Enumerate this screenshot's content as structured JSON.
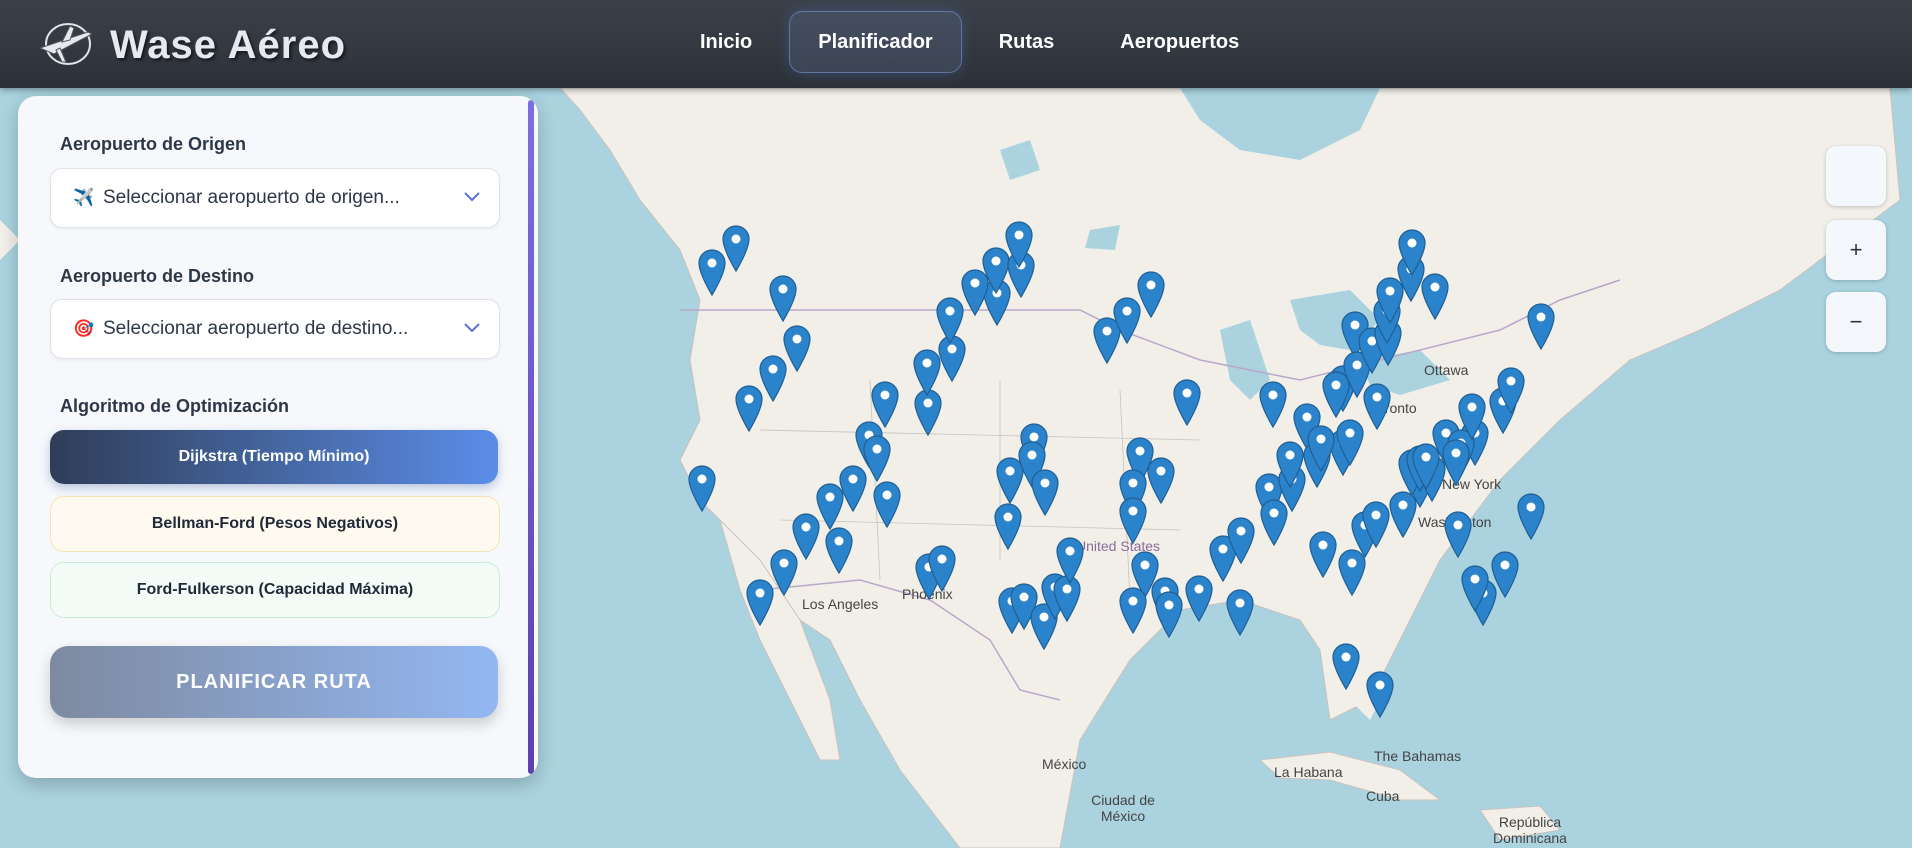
{
  "app": {
    "title": "Wase Aéreo"
  },
  "nav": [
    {
      "label": "Inicio",
      "active": false
    },
    {
      "label": "Planificador",
      "active": true
    },
    {
      "label": "Rutas",
      "active": false
    },
    {
      "label": "Aeropuertos",
      "active": false
    }
  ],
  "panel": {
    "origin": {
      "label": "Aeropuerto de Origen",
      "placeholder": "Seleccionar aeropuerto de origen...",
      "icon": "airplane-icon"
    },
    "destination": {
      "label": "Aeropuerto de Destino",
      "placeholder": "Seleccionar aeropuerto de destino...",
      "icon": "target-icon"
    },
    "algorithm": {
      "label": "Algoritmo de Optimización",
      "options": [
        {
          "label": "Dijkstra (Tiempo Mínimo)",
          "selected": true
        },
        {
          "label": "Bellman-Ford (Pesos Negativos)",
          "selected": false
        },
        {
          "label": "Ford-Fulkerson (Capacidad Máxima)",
          "selected": false
        }
      ]
    },
    "plan_button": "PLANIFICAR RUTA"
  },
  "map": {
    "controls": {
      "zoom_in": "+",
      "zoom_out": "−"
    },
    "cities": [
      "Ottawa",
      "Toronto",
      "New York",
      "Washington",
      "Los Angeles",
      "Phoenix",
      "United States",
      "México",
      "Ciudad de México",
      "La Habana",
      "Cuba",
      "The Bahamas",
      "República Dominicana"
    ],
    "marker_color": "#2b83cb"
  }
}
